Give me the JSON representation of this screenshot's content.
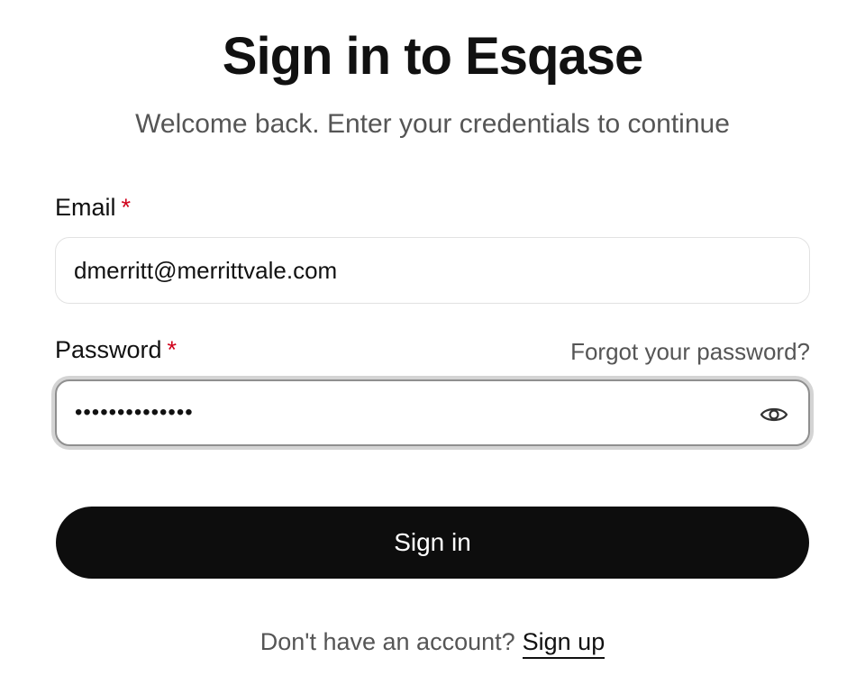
{
  "header": {
    "title": "Sign in to Esqase",
    "subtitle": "Welcome back. Enter your credentials to continue"
  },
  "form": {
    "email": {
      "label": "Email",
      "required_mark": "*",
      "value": "dmerritt@merrittvale.com"
    },
    "password": {
      "label": "Password",
      "required_mark": "*",
      "value": "••••••••••••••",
      "forgot_link": "Forgot your password?",
      "toggle_icon": "eye-icon"
    },
    "submit_label": "Sign in"
  },
  "footer": {
    "prompt": "Don't have an account?",
    "link_label": "Sign up"
  },
  "colors": {
    "button_bg": "#0d0d0d",
    "required": "#d0021b",
    "muted_text": "#555555"
  }
}
